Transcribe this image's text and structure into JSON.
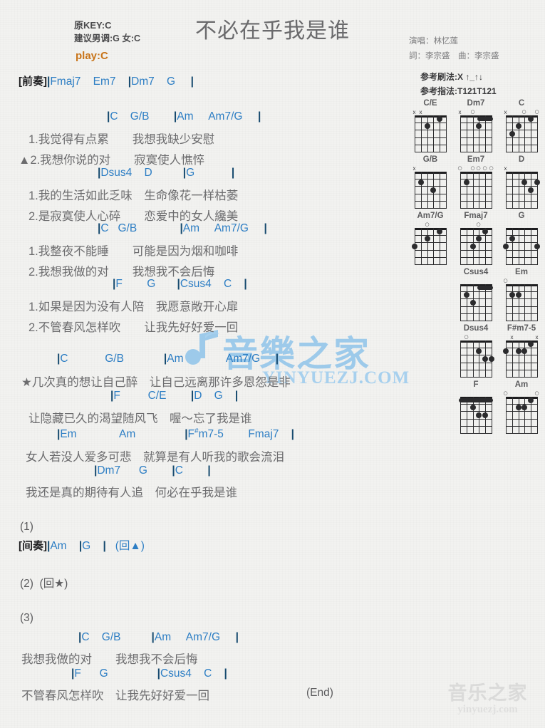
{
  "header": {
    "original_key": "原KEY:C",
    "suggested_key": "建议男调:G 女:C",
    "play_key": "play:C",
    "title": "不必在乎我是谁",
    "singer": "演唱：林忆莲",
    "writers": "詞：李宗盛　曲：李宗盛",
    "strum_pattern": "参考刷法:X ↑_↑↓",
    "finger_pattern": "参考指法:T121T121"
  },
  "body": {
    "intro_tag": "[前奏]",
    "intro_chords": "|Fmaj7    Em7    |Dm7    G     |",
    "v1_chords_1": "|C    G/B        |Am     Am7/G     |",
    "v1_lyric_1a": "1.我觉得有点累　　我想我缺少安慰",
    "v1_lyric_1b": "▲2.我想你说的对　　寂寞使人憔悴",
    "v1_chords_2": "|Dsus4    D          |G            |",
    "v1_lyric_2a": "1.我的生活如此乏味　生命像花一样枯萎",
    "v1_lyric_2b": "2.是寂寞使人心碎　　恋爱中的女人纔美",
    "v1_chords_3": "|C   G/B              |Am     Am7/G     |",
    "v1_lyric_3a": "1.我整夜不能睡　　可能是因为烟和咖啡",
    "v1_lyric_3b": "2.我想我做的对　　我想我不会后悔",
    "v1_chords_4": "|F        G       |Csus4    C    |",
    "v1_lyric_4a": "1.如果是因为没有人陪　我愿意敞开心扉",
    "v1_lyric_4b": "2.不管春风怎样吹　　让我先好好爱一回",
    "ch_chords_1": "|C            G/B             |Am              Am7/G     |",
    "ch_lyric_1": "★几次真的想让自己醉　让自己远离那许多恩怨是非",
    "ch_chords_2": "|F         C/E        |D    G    |",
    "ch_lyric_2": "让隐藏已久的渴望随风飞　喔～忘了我是谁",
    "ch_chords_3": "|Em              Am                |F#m7-5        Fmaj7    |",
    "ch_lyric_3": "女人若没人爱多可悲　就算是有人听我的歌会流泪",
    "ch_chords_4": "|Dm7      G        |C        |",
    "ch_lyric_4": "我还是真的期待有人追　何必在乎我是谁",
    "sec1_num": "(1)",
    "sec1_tag": "[间奏]",
    "sec1_chords": "|Am    |G    |   (回▲)",
    "sec2": "(2)  (回★)",
    "sec3_num": "(3)",
    "sec3_chords_1": "|C    G/B          |Am     Am7/G     |",
    "sec3_lyric_1": "我想我做的对　　我想我不会后悔",
    "sec3_chords_2": "|F      G                |Csus4    C    |",
    "sec3_lyric_2": "不管春风怎样吹　让我先好好爱一回",
    "end_mark": "(End)"
  },
  "watermark": {
    "center_text": "音樂之家",
    "center_sub": "YINYUEZJ.COM",
    "bottom_text": "音乐之家",
    "bottom_sub": "yinyuezj.com"
  },
  "diagrams": [
    [
      {
        "name": "C/E",
        "markers": [
          {
            "t": "x",
            "s": 6
          },
          {
            "t": "x",
            "s": 5
          }
        ],
        "dots": [
          {
            "s": 4,
            "f": 2
          },
          {
            "s": 2,
            "f": 1
          }
        ],
        "barre": null
      },
      {
        "name": "Dm7",
        "markers": [
          {
            "t": "x",
            "s": 6
          },
          {
            "t": "o",
            "s": 4
          }
        ],
        "dots": [
          {
            "s": 3,
            "f": 2
          }
        ],
        "barre": {
          "f": 1,
          "from": 3,
          "to": 1
        }
      },
      {
        "name": "C",
        "markers": [
          {
            "t": "x",
            "s": 6
          },
          {
            "t": "o",
            "s": 3
          },
          {
            "t": "o",
            "s": 1
          }
        ],
        "dots": [
          {
            "s": 5,
            "f": 3
          },
          {
            "s": 4,
            "f": 2
          },
          {
            "s": 2,
            "f": 1
          }
        ],
        "barre": null
      }
    ],
    [
      {
        "name": "G/B",
        "markers": [
          {
            "t": "x",
            "s": 6
          }
        ],
        "dots": [
          {
            "s": 5,
            "f": 2
          },
          {
            "s": 3,
            "f": 3
          }
        ],
        "barre": null
      },
      {
        "name": "Em7",
        "markers": [
          {
            "t": "o",
            "s": 6
          },
          {
            "t": "o",
            "s": 4
          },
          {
            "t": "o",
            "s": 3
          },
          {
            "t": "o",
            "s": 2
          },
          {
            "t": "o",
            "s": 1
          }
        ],
        "dots": [
          {
            "s": 5,
            "f": 2
          }
        ],
        "barre": null
      },
      {
        "name": "D",
        "markers": [
          {
            "t": "x",
            "s": 6
          }
        ],
        "dots": [
          {
            "s": 3,
            "f": 2
          },
          {
            "s": 1,
            "f": 2
          },
          {
            "s": 2,
            "f": 3
          }
        ],
        "barre": null
      }
    ],
    [
      {
        "name": "Am7/G",
        "markers": [
          {
            "t": "o",
            "s": 4
          }
        ],
        "dots": [
          {
            "s": 6,
            "f": 3
          },
          {
            "s": 4,
            "f": 2
          },
          {
            "s": 2,
            "f": 1
          }
        ],
        "barre": null
      },
      {
        "name": "Fmaj7",
        "markers": [
          {
            "t": "o",
            "s": 3
          }
        ],
        "dots": [
          {
            "s": 4,
            "f": 3
          },
          {
            "s": 3,
            "f": 2
          },
          {
            "s": 2,
            "f": 1
          }
        ],
        "barre": null
      },
      {
        "name": "G",
        "markers": [],
        "dots": [
          {
            "s": 6,
            "f": 3
          },
          {
            "s": 5,
            "f": 2
          },
          {
            "s": 1,
            "f": 3
          }
        ],
        "barre": null
      }
    ],
    [
      {
        "name": "",
        "markers": [],
        "dots": [],
        "barre": null,
        "blank": true
      },
      {
        "name": "Csus4",
        "markers": [],
        "dots": [
          {
            "s": 4,
            "f": 3
          },
          {
            "s": 5,
            "f": 2
          }
        ],
        "barre": {
          "f": 1,
          "from": 3,
          "to": 1
        }
      },
      {
        "name": "Em",
        "markers": [
          {
            "t": "o",
            "s": 6
          }
        ],
        "dots": [
          {
            "s": 5,
            "f": 2
          },
          {
            "s": 4,
            "f": 2
          }
        ],
        "barre": null
      }
    ],
    [
      {
        "name": "",
        "markers": [],
        "dots": [],
        "barre": null,
        "blank": true
      },
      {
        "name": "Dsus4",
        "markers": [
          {
            "t": "o",
            "s": 5
          }
        ],
        "dots": [
          {
            "s": 3,
            "f": 2
          },
          {
            "s": 2,
            "f": 3
          },
          {
            "s": 1,
            "f": 3
          }
        ],
        "barre": null
      },
      {
        "name": "F#m7-5",
        "markers": [
          {
            "t": "x",
            "s": 5
          },
          {
            "t": "x",
            "s": 1
          }
        ],
        "dots": [
          {
            "s": 6,
            "f": 2
          },
          {
            "s": 4,
            "f": 2
          },
          {
            "s": 3,
            "f": 2
          },
          {
            "s": 2,
            "f": 1
          }
        ],
        "barre": null
      }
    ],
    [
      {
        "name": "",
        "markers": [],
        "dots": [],
        "barre": null,
        "blank": true
      },
      {
        "name": "F",
        "markers": [],
        "dots": [
          {
            "s": 4,
            "f": 2
          },
          {
            "s": 3,
            "f": 3
          },
          {
            "s": 2,
            "f": 3
          }
        ],
        "barre": {
          "f": 1,
          "from": 6,
          "to": 1
        }
      },
      {
        "name": "Am",
        "markers": [
          {
            "t": "o",
            "s": 6
          },
          {
            "t": "o",
            "s": 1
          }
        ],
        "dots": [
          {
            "s": 4,
            "f": 2
          },
          {
            "s": 3,
            "f": 2
          },
          {
            "s": 2,
            "f": 1
          }
        ],
        "barre": null
      }
    ]
  ]
}
